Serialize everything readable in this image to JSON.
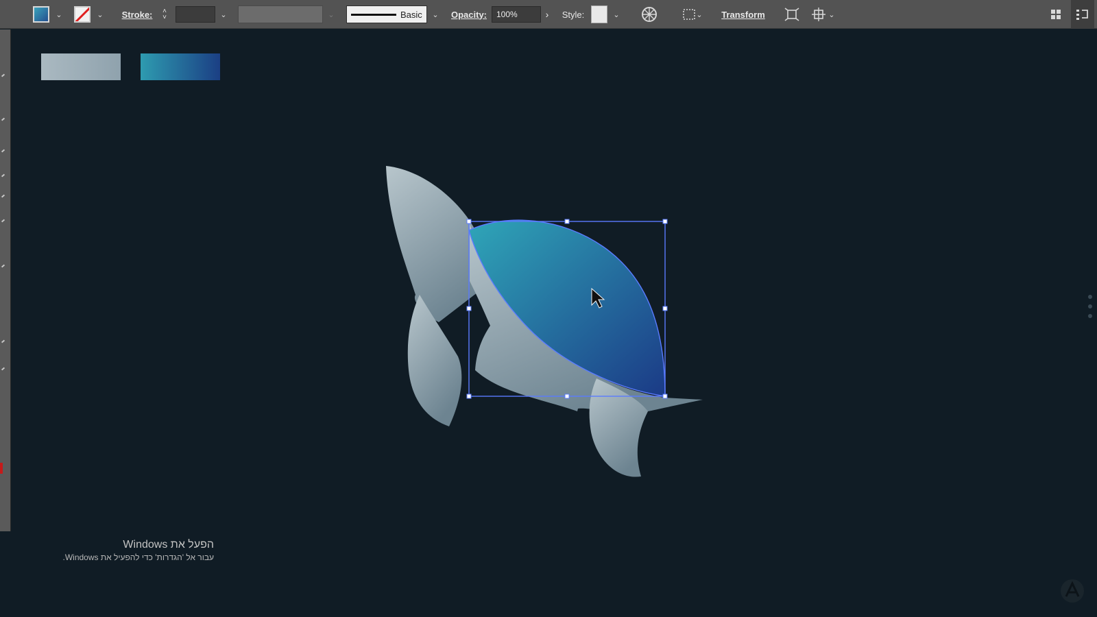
{
  "control_bar": {
    "fill_icon": "fill-swatch-icon",
    "stroke_icon": "stroke-none-swatch-icon",
    "stroke_label": "Stroke:",
    "stroke_weight_value": "",
    "variable_width_value": "",
    "brush_label": "Basic",
    "opacity_label": "Opacity:",
    "opacity_value": "100%",
    "style_label": "Style:",
    "transform_label": "Transform",
    "colors": {
      "fill": "#2f8aa8",
      "stroke_none_slash": "#e02020"
    }
  },
  "artboard": {
    "gradient_swatches": [
      {
        "name": "gray-gradient",
        "from": "#aab9c1",
        "to": "#8fa2ad"
      },
      {
        "name": "blue-gradient",
        "from": "#2e9bb0",
        "to": "#1b3f84"
      }
    ],
    "whale_colors": {
      "body_light": "#b5c3ca",
      "body_dark": "#6f8592",
      "shell_light": "#2e9fb5",
      "shell_dark": "#1c3c86",
      "selection": "#5a7bff"
    }
  },
  "watermark": {
    "title": "הפעל את Windows",
    "subtitle": "עבור אל 'הגדרות' כדי להפעיל את Windows."
  },
  "corner_logo_icon": "app-logo-icon"
}
